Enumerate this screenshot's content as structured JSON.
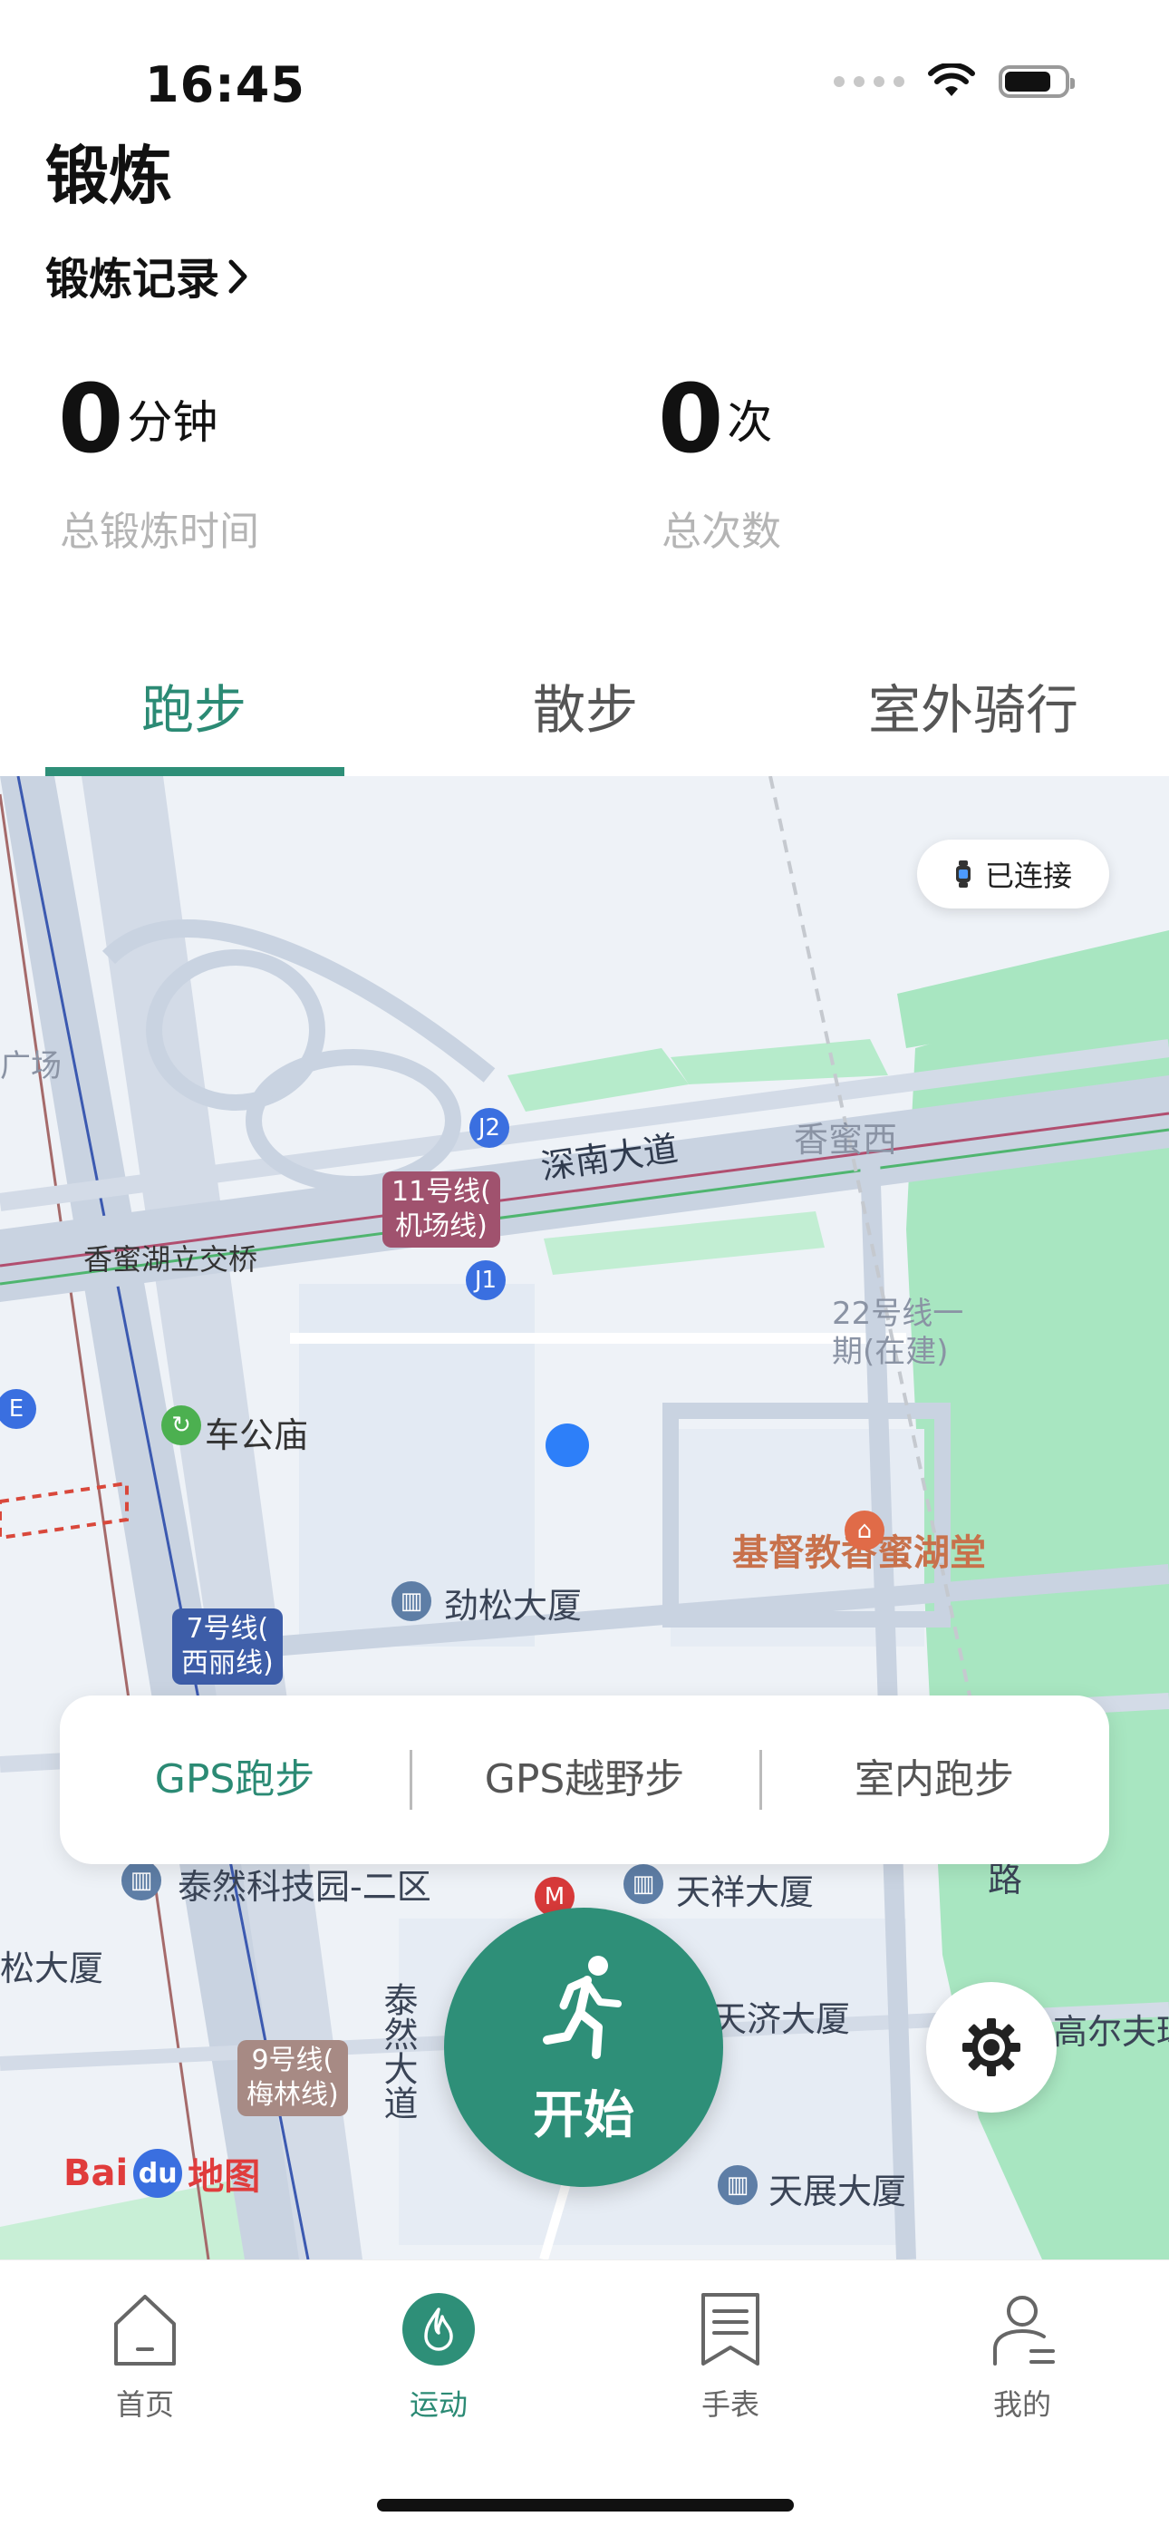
{
  "status_bar": {
    "time": "16:45"
  },
  "page": {
    "title": "锻炼",
    "records_link": "锻炼记录"
  },
  "stats": [
    {
      "value": "0",
      "unit": "分钟",
      "label": "总锻炼时间"
    },
    {
      "value": "0",
      "unit": "次",
      "label": "总次数"
    }
  ],
  "tabs": [
    {
      "label": "跑步",
      "active": true
    },
    {
      "label": "散步",
      "active": false
    },
    {
      "label": "室外骑行",
      "active": false
    }
  ],
  "map": {
    "connection_status": "已连接",
    "labels": {
      "airport_fragment": "广场",
      "xiangmi_lake_bridge": "香蜜湖立交桥",
      "shennan_road": "深南大道",
      "xiangmi_west": "香蜜西",
      "line22": "22号线一\n期(在建)",
      "chegongmiao": "车公庙",
      "church": "基督教香蜜湖堂",
      "jinsong_building": "劲松大厦",
      "tairan_park": "泰然科技园-二区",
      "tianxiang_building": "天祥大厦",
      "tianji_building": "天济大厦",
      "tianzhan_building": "天展大厦",
      "tairan_road": "泰然大道",
      "left_building": "松大厦",
      "golf": "高尔夫球",
      "road_fragment": "路",
      "baidu_map": "地图"
    },
    "metro_tags": [
      {
        "text": "11号线(\n机场线)",
        "color": "#a0526e"
      },
      {
        "text": "7号线(\n西丽线)",
        "color": "#3d5da8"
      },
      {
        "text": "9号线(\n梅林线)",
        "color": "#a78a84"
      }
    ],
    "exit_tags": [
      "J2",
      "J1",
      "E"
    ]
  },
  "run_modes": [
    {
      "label": "GPS跑步",
      "active": true
    },
    {
      "label": "GPS越野步",
      "active": false
    },
    {
      "label": "室内跑步",
      "active": false
    }
  ],
  "start_button": {
    "label": "开始"
  },
  "bottom_nav": [
    {
      "label": "首页",
      "icon": "home-icon",
      "active": false
    },
    {
      "label": "运动",
      "icon": "flame-icon",
      "active": true
    },
    {
      "label": "手表",
      "icon": "watch-bookmark-icon",
      "active": false
    },
    {
      "label": "我的",
      "icon": "profile-icon",
      "active": false
    }
  ],
  "colors": {
    "accent": "#2e8f78",
    "map_green": "#a8e6c1",
    "map_road": "#c9d3e1"
  }
}
